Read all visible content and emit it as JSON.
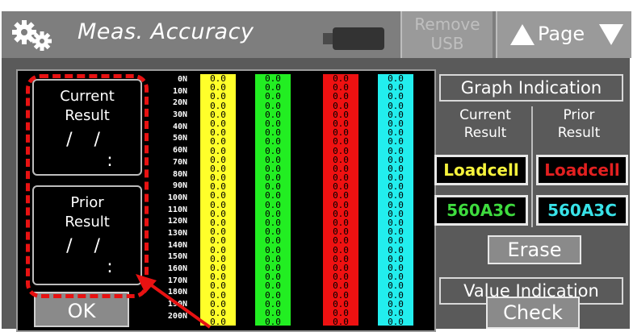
{
  "header": {
    "title": "Meas. Accuracy",
    "remove_usb_line1": "Remove",
    "remove_usb_line2": "USB",
    "page_label": "Page",
    "icons": [
      "gears-icon",
      "usb-drive-icon",
      "page-up-icon",
      "page-down-icon"
    ]
  },
  "results": {
    "current": {
      "line1": "Current",
      "line2": "Result",
      "date": "/ /",
      "time": ":"
    },
    "prior": {
      "line1": "Prior",
      "line2": "Result",
      "date": "/ /",
      "time": ":"
    }
  },
  "ok_label": "OK",
  "scale": [
    "0N",
    "10N",
    "20N",
    "30N",
    "40N",
    "50N",
    "60N",
    "70N",
    "80N",
    "90N",
    "100N",
    "110N",
    "120N",
    "130N",
    "140N",
    "150N",
    "160N",
    "170N",
    "180N",
    "190N",
    "200N"
  ],
  "columns": [
    {
      "color": "#ffff2a",
      "values": [
        "0.0",
        "0.0",
        "0.0",
        "0.0",
        "0.0",
        "0.0",
        "0.0",
        "0.0",
        "0.0",
        "0.0",
        "0.0",
        "0.0",
        "0.0",
        "0.0",
        "0.0",
        "0.0",
        "0.0",
        "0.0",
        "0.0",
        "0.0",
        "0.0",
        "0.0",
        "0.0",
        "0.0",
        "0.0",
        "0.0",
        "0.0",
        "0.0"
      ]
    },
    {
      "color": "#22ee22",
      "values": [
        "0.0",
        "0.0",
        "0.0",
        "0.0",
        "0.0",
        "0.0",
        "0.0",
        "0.0",
        "0.0",
        "0.0",
        "0.0",
        "0.0",
        "0.0",
        "0.0",
        "0.0",
        "0.0",
        "0.0",
        "0.0",
        "0.0",
        "0.0",
        "0.0",
        "0.0",
        "0.0",
        "0.0",
        "0.0",
        "0.0",
        "0.0",
        "0.0"
      ]
    },
    {
      "color": "#ee1111",
      "values": [
        "0.0",
        "0.0",
        "0.0",
        "0.0",
        "0.0",
        "0.0",
        "0.0",
        "0.0",
        "0.0",
        "0.0",
        "0.0",
        "0.0",
        "0.0",
        "0.0",
        "0.0",
        "0.0",
        "0.0",
        "0.0",
        "0.0",
        "0.0",
        "0.0",
        "0.0",
        "0.0",
        "0.0",
        "0.0",
        "0.0",
        "0.0",
        "0.0"
      ]
    },
    {
      "color": "#22eeee",
      "values": [
        "0.0",
        "0.0",
        "0.0",
        "0.0",
        "0.0",
        "0.0",
        "0.0",
        "0.0",
        "0.0",
        "0.0",
        "0.0",
        "0.0",
        "0.0",
        "0.0",
        "0.0",
        "0.0",
        "0.0",
        "0.0",
        "0.0",
        "0.0",
        "0.0",
        "0.0",
        "0.0",
        "0.0",
        "0.0",
        "0.0",
        "0.0",
        "0.0"
      ]
    }
  ],
  "graph_indication": {
    "title": "Graph Indication",
    "current_line1": "Current",
    "current_line2": "Result",
    "prior_line1": "Prior",
    "prior_line2": "Result",
    "loadcell_current": "Loadcell",
    "loadcell_prior": "Loadcell",
    "sensor_current": "560A3C",
    "sensor_prior": "560A3C",
    "erase_label": "Erase"
  },
  "value_indication": {
    "title": "Value Indication",
    "check_label": "Check"
  },
  "colors": {
    "highlight": "#e81212",
    "loadcell_current": "#f5f23c",
    "loadcell_prior": "#e22020",
    "sensor_current": "#3edb3e",
    "sensor_prior": "#38e2e8"
  }
}
